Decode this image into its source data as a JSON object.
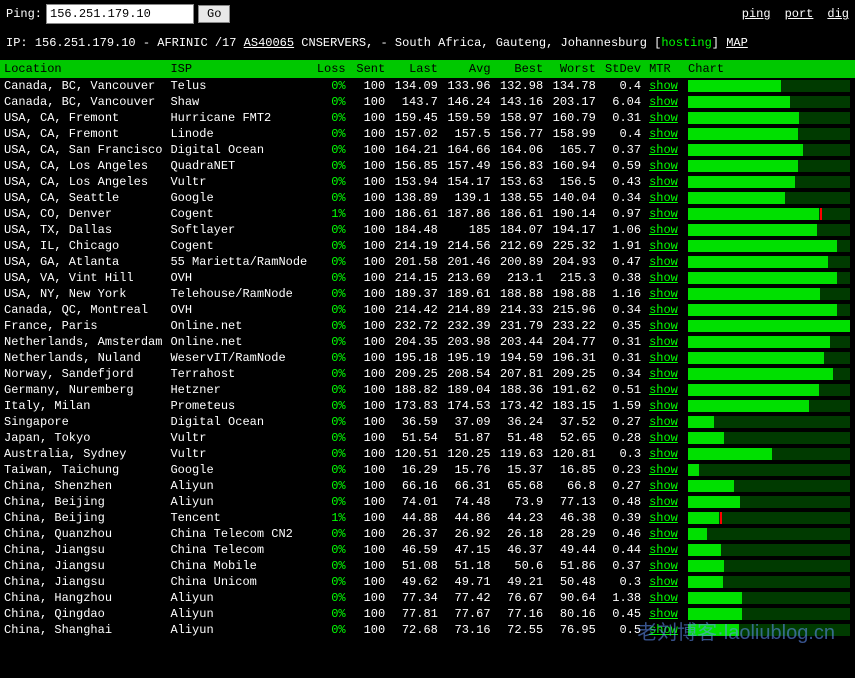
{
  "topbar": {
    "ping_label": "Ping:",
    "ip_value": "156.251.179.10",
    "go_label": "Go",
    "links": [
      "ping",
      "port",
      "dig"
    ]
  },
  "info": {
    "prefix": "IP: ",
    "ip": "156.251.179.10",
    "dash": " - AFRINIC /17 ",
    "asn": "AS40065",
    "after_asn": " CNSERVERS, - South Africa, Gauteng, Johannesburg [",
    "hosting": "hosting",
    "after_hosting": "] ",
    "map": "MAP"
  },
  "headers": [
    "Location",
    "ISP",
    "Loss",
    "Sent",
    "Last",
    "Avg",
    "Best",
    "Worst",
    "StDev",
    "MTR",
    "Chart"
  ],
  "show_label": "show",
  "max_avg": 233,
  "rows": [
    {
      "loc": "Canada, BC, Vancouver",
      "isp": "Telus",
      "loss": "0%",
      "sent": "100",
      "last": "134.09",
      "avg": "133.96",
      "best": "132.98",
      "worst": "134.78",
      "stdev": "0.4"
    },
    {
      "loc": "Canada, BC, Vancouver",
      "isp": "Shaw",
      "loss": "0%",
      "sent": "100",
      "last": "143.7",
      "avg": "146.24",
      "best": "143.16",
      "worst": "203.17",
      "stdev": "6.04"
    },
    {
      "loc": "USA, CA, Fremont",
      "isp": "Hurricane FMT2",
      "loss": "0%",
      "sent": "100",
      "last": "159.45",
      "avg": "159.59",
      "best": "158.97",
      "worst": "160.79",
      "stdev": "0.31"
    },
    {
      "loc": "USA, CA, Fremont",
      "isp": "Linode",
      "loss": "0%",
      "sent": "100",
      "last": "157.02",
      "avg": "157.5",
      "best": "156.77",
      "worst": "158.99",
      "stdev": "0.4"
    },
    {
      "loc": "USA, CA, San Francisco",
      "isp": "Digital Ocean",
      "loss": "0%",
      "sent": "100",
      "last": "164.21",
      "avg": "164.66",
      "best": "164.06",
      "worst": "165.7",
      "stdev": "0.37"
    },
    {
      "loc": "USA, CA, Los Angeles",
      "isp": "QuadraNET",
      "loss": "0%",
      "sent": "100",
      "last": "156.85",
      "avg": "157.49",
      "best": "156.83",
      "worst": "160.94",
      "stdev": "0.59"
    },
    {
      "loc": "USA, CA, Los Angeles",
      "isp": "Vultr",
      "loss": "0%",
      "sent": "100",
      "last": "153.94",
      "avg": "154.17",
      "best": "153.63",
      "worst": "156.5",
      "stdev": "0.43"
    },
    {
      "loc": "USA, CA, Seattle",
      "isp": "Google",
      "loss": "0%",
      "sent": "100",
      "last": "138.89",
      "avg": "139.1",
      "best": "138.55",
      "worst": "140.04",
      "stdev": "0.34"
    },
    {
      "loc": "USA, CO, Denver",
      "isp": "Cogent",
      "loss": "1%",
      "sent": "100",
      "last": "186.61",
      "avg": "187.86",
      "best": "186.61",
      "worst": "190.14",
      "stdev": "0.97",
      "mark": true
    },
    {
      "loc": "USA, TX, Dallas",
      "isp": "Softlayer",
      "loss": "0%",
      "sent": "100",
      "last": "184.48",
      "avg": "185",
      "best": "184.07",
      "worst": "194.17",
      "stdev": "1.06"
    },
    {
      "loc": "USA, IL, Chicago",
      "isp": "Cogent",
      "loss": "0%",
      "sent": "100",
      "last": "214.19",
      "avg": "214.56",
      "best": "212.69",
      "worst": "225.32",
      "stdev": "1.91"
    },
    {
      "loc": "USA, GA, Atlanta",
      "isp": "55 Marietta/RamNode",
      "loss": "0%",
      "sent": "100",
      "last": "201.58",
      "avg": "201.46",
      "best": "200.89",
      "worst": "204.93",
      "stdev": "0.47"
    },
    {
      "loc": "USA, VA, Vint Hill",
      "isp": "OVH",
      "loss": "0%",
      "sent": "100",
      "last": "214.15",
      "avg": "213.69",
      "best": "213.1",
      "worst": "215.3",
      "stdev": "0.38"
    },
    {
      "loc": "USA, NY, New York",
      "isp": "Telehouse/RamNode",
      "loss": "0%",
      "sent": "100",
      "last": "189.37",
      "avg": "189.61",
      "best": "188.88",
      "worst": "198.88",
      "stdev": "1.16"
    },
    {
      "loc": "Canada, QC, Montreal",
      "isp": "OVH",
      "loss": "0%",
      "sent": "100",
      "last": "214.42",
      "avg": "214.89",
      "best": "214.33",
      "worst": "215.96",
      "stdev": "0.34"
    },
    {
      "loc": "France, Paris",
      "isp": "Online.net",
      "loss": "0%",
      "sent": "100",
      "last": "232.72",
      "avg": "232.39",
      "best": "231.79",
      "worst": "233.22",
      "stdev": "0.35"
    },
    {
      "loc": "Netherlands, Amsterdam",
      "isp": "Online.net",
      "loss": "0%",
      "sent": "100",
      "last": "204.35",
      "avg": "203.98",
      "best": "203.44",
      "worst": "204.77",
      "stdev": "0.31"
    },
    {
      "loc": "Netherlands, Nuland",
      "isp": "WeservIT/RamNode",
      "loss": "0%",
      "sent": "100",
      "last": "195.18",
      "avg": "195.19",
      "best": "194.59",
      "worst": "196.31",
      "stdev": "0.31"
    },
    {
      "loc": "Norway, Sandefjord",
      "isp": "Terrahost",
      "loss": "0%",
      "sent": "100",
      "last": "209.25",
      "avg": "208.54",
      "best": "207.81",
      "worst": "209.25",
      "stdev": "0.34"
    },
    {
      "loc": "Germany, Nuremberg",
      "isp": "Hetzner",
      "loss": "0%",
      "sent": "100",
      "last": "188.82",
      "avg": "189.04",
      "best": "188.36",
      "worst": "191.62",
      "stdev": "0.51"
    },
    {
      "loc": "Italy, Milan",
      "isp": "Prometeus",
      "loss": "0%",
      "sent": "100",
      "last": "173.83",
      "avg": "174.53",
      "best": "173.42",
      "worst": "183.15",
      "stdev": "1.59"
    },
    {
      "loc": "Singapore",
      "isp": "Digital Ocean",
      "loss": "0%",
      "sent": "100",
      "last": "36.59",
      "avg": "37.09",
      "best": "36.24",
      "worst": "37.52",
      "stdev": "0.27"
    },
    {
      "loc": "Japan, Tokyo",
      "isp": "Vultr",
      "loss": "0%",
      "sent": "100",
      "last": "51.54",
      "avg": "51.87",
      "best": "51.48",
      "worst": "52.65",
      "stdev": "0.28"
    },
    {
      "loc": "Australia, Sydney",
      "isp": "Vultr",
      "loss": "0%",
      "sent": "100",
      "last": "120.51",
      "avg": "120.25",
      "best": "119.63",
      "worst": "120.81",
      "stdev": "0.3"
    },
    {
      "loc": "Taiwan, Taichung",
      "isp": "Google",
      "loss": "0%",
      "sent": "100",
      "last": "16.29",
      "avg": "15.76",
      "best": "15.37",
      "worst": "16.85",
      "stdev": "0.23"
    },
    {
      "loc": "China, Shenzhen",
      "isp": "Aliyun",
      "loss": "0%",
      "sent": "100",
      "last": "66.16",
      "avg": "66.31",
      "best": "65.68",
      "worst": "66.8",
      "stdev": "0.27"
    },
    {
      "loc": "China, Beijing",
      "isp": "Aliyun",
      "loss": "0%",
      "sent": "100",
      "last": "74.01",
      "avg": "74.48",
      "best": "73.9",
      "worst": "77.13",
      "stdev": "0.48"
    },
    {
      "loc": "China, Beijing",
      "isp": "Tencent",
      "loss": "1%",
      "sent": "100",
      "last": "44.88",
      "avg": "44.86",
      "best": "44.23",
      "worst": "46.38",
      "stdev": "0.39",
      "mark": true
    },
    {
      "loc": "China, Quanzhou",
      "isp": "China Telecom CN2",
      "loss": "0%",
      "sent": "100",
      "last": "26.37",
      "avg": "26.92",
      "best": "26.18",
      "worst": "28.29",
      "stdev": "0.46"
    },
    {
      "loc": "China, Jiangsu",
      "isp": "China Telecom",
      "loss": "0%",
      "sent": "100",
      "last": "46.59",
      "avg": "47.15",
      "best": "46.37",
      "worst": "49.44",
      "stdev": "0.44"
    },
    {
      "loc": "China, Jiangsu",
      "isp": "China Mobile",
      "loss": "0%",
      "sent": "100",
      "last": "51.08",
      "avg": "51.18",
      "best": "50.6",
      "worst": "51.86",
      "stdev": "0.37"
    },
    {
      "loc": "China, Jiangsu",
      "isp": "China Unicom",
      "loss": "0%",
      "sent": "100",
      "last": "49.62",
      "avg": "49.71",
      "best": "49.21",
      "worst": "50.48",
      "stdev": "0.3"
    },
    {
      "loc": "China, Hangzhou",
      "isp": "Aliyun",
      "loss": "0%",
      "sent": "100",
      "last": "77.34",
      "avg": "77.42",
      "best": "76.67",
      "worst": "90.64",
      "stdev": "1.38"
    },
    {
      "loc": "China, Qingdao",
      "isp": "Aliyun",
      "loss": "0%",
      "sent": "100",
      "last": "77.81",
      "avg": "77.67",
      "best": "77.16",
      "worst": "80.16",
      "stdev": "0.45"
    },
    {
      "loc": "China, Shanghai",
      "isp": "Aliyun",
      "loss": "0%",
      "sent": "100",
      "last": "72.68",
      "avg": "73.16",
      "best": "72.55",
      "worst": "76.95",
      "stdev": "0.5"
    }
  ],
  "watermark": "老刘博客·laoliublog.cn"
}
